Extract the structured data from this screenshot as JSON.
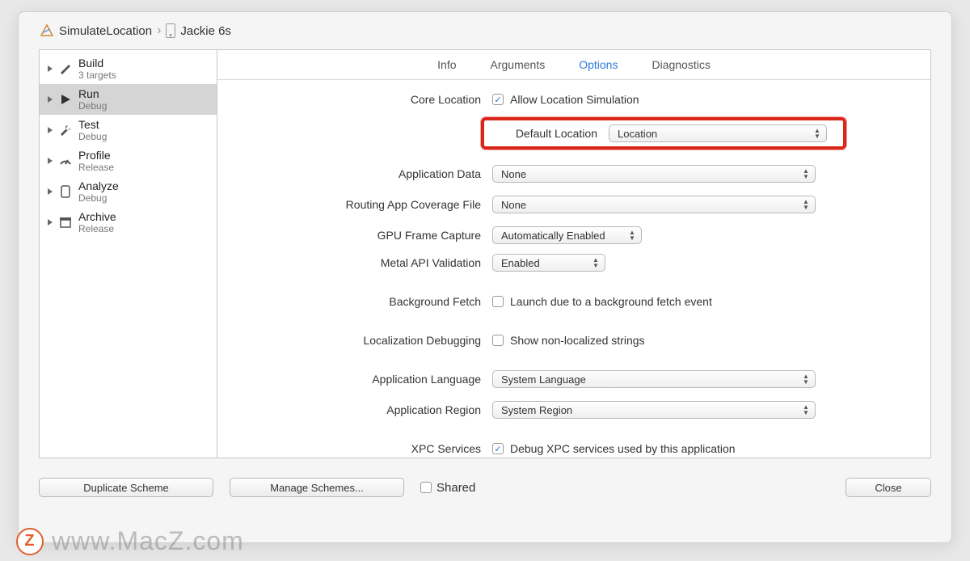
{
  "breadcrumb": {
    "scheme": "SimulateLocation",
    "device": "Jackie 6s"
  },
  "sidebar": [
    {
      "title": "Build",
      "sub": "3 targets",
      "icon": "hammer"
    },
    {
      "title": "Run",
      "sub": "Debug",
      "icon": "play",
      "selected": true
    },
    {
      "title": "Test",
      "sub": "Debug",
      "icon": "wrench"
    },
    {
      "title": "Profile",
      "sub": "Release",
      "icon": "gauge"
    },
    {
      "title": "Analyze",
      "sub": "Debug",
      "icon": "device"
    },
    {
      "title": "Archive",
      "sub": "Release",
      "icon": "archive"
    }
  ],
  "tabs": {
    "items": [
      "Info",
      "Arguments",
      "Options",
      "Diagnostics"
    ],
    "active": 2
  },
  "options": {
    "core_location_label": "Core Location",
    "allow_location_simulation_label": "Allow Location Simulation",
    "allow_location_simulation_checked": true,
    "default_location_label": "Default Location",
    "default_location_value": "Location",
    "application_data_label": "Application Data",
    "application_data_value": "None",
    "routing_app_label": "Routing App Coverage File",
    "routing_app_value": "None",
    "gpu_frame_capture_label": "GPU Frame Capture",
    "gpu_frame_capture_value": "Automatically Enabled",
    "metal_api_label": "Metal API Validation",
    "metal_api_value": "Enabled",
    "background_fetch_label": "Background Fetch",
    "background_fetch_checkbox_label": "Launch due to a background fetch event",
    "background_fetch_checked": false,
    "localization_debugging_label": "Localization Debugging",
    "localization_checkbox_label": "Show non-localized strings",
    "localization_checked": false,
    "application_language_label": "Application Language",
    "application_language_value": "System Language",
    "application_region_label": "Application Region",
    "application_region_value": "System Region",
    "xpc_services_label": "XPC Services",
    "xpc_checkbox_label": "Debug XPC services used by this application",
    "xpc_checked": true
  },
  "footer": {
    "duplicate_scheme": "Duplicate Scheme",
    "manage_schemes": "Manage Schemes...",
    "shared": "Shared",
    "shared_checked": false,
    "close": "Close"
  },
  "watermark": "www.MacZ.com"
}
